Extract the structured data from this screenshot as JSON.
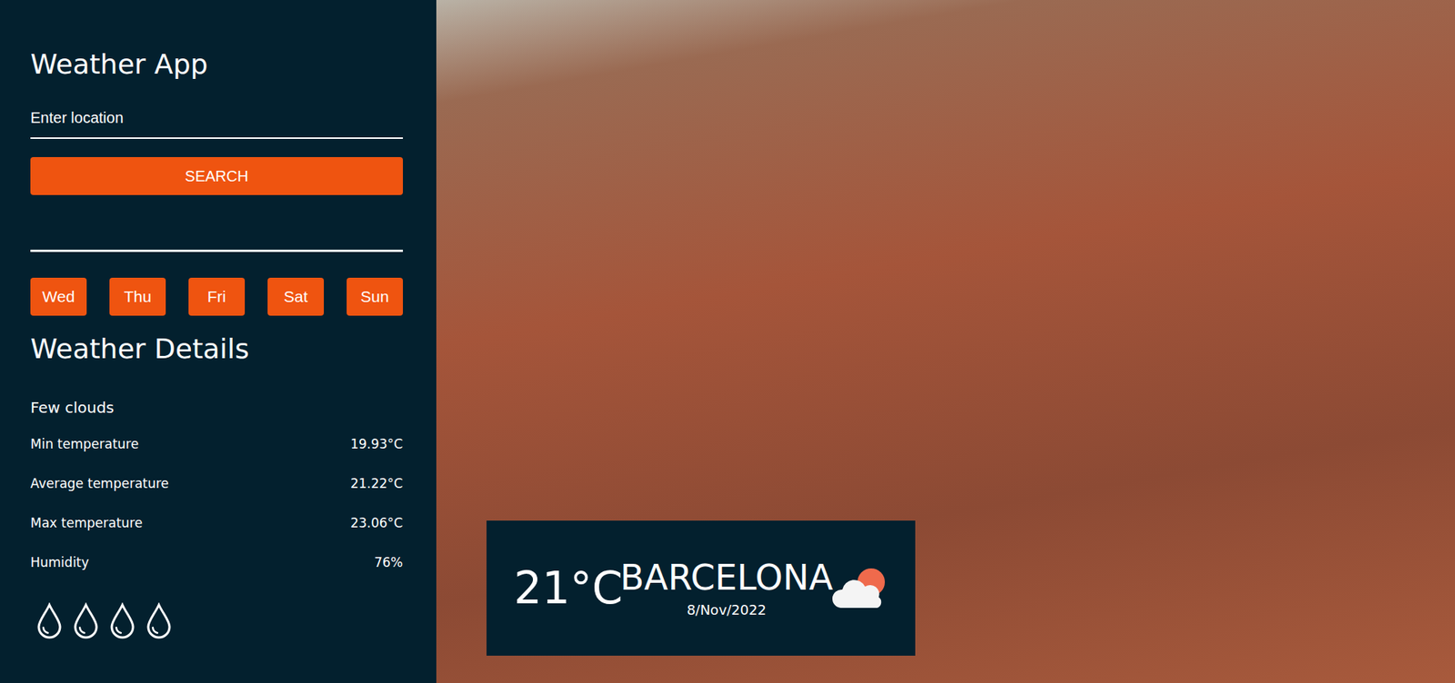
{
  "app": {
    "title": "Weather App"
  },
  "search": {
    "placeholder": "Enter location",
    "button": "SEARCH"
  },
  "days": [
    {
      "label": "Wed"
    },
    {
      "label": "Thu"
    },
    {
      "label": "Fri"
    },
    {
      "label": "Sat"
    },
    {
      "label": "Sun"
    }
  ],
  "details": {
    "title": "Weather Details",
    "condition": "Few clouds",
    "rows": [
      {
        "label": "Min temperature",
        "value": "19.93°C"
      },
      {
        "label": "Average temperature",
        "value": "21.22°C"
      },
      {
        "label": "Max temperature",
        "value": "23.06°C"
      },
      {
        "label": "Humidity",
        "value": "76%"
      }
    ],
    "humidity_drops": 4
  },
  "card": {
    "temperature": "21°C",
    "city": "BARCELONA",
    "date": "8/Nov/2022"
  }
}
